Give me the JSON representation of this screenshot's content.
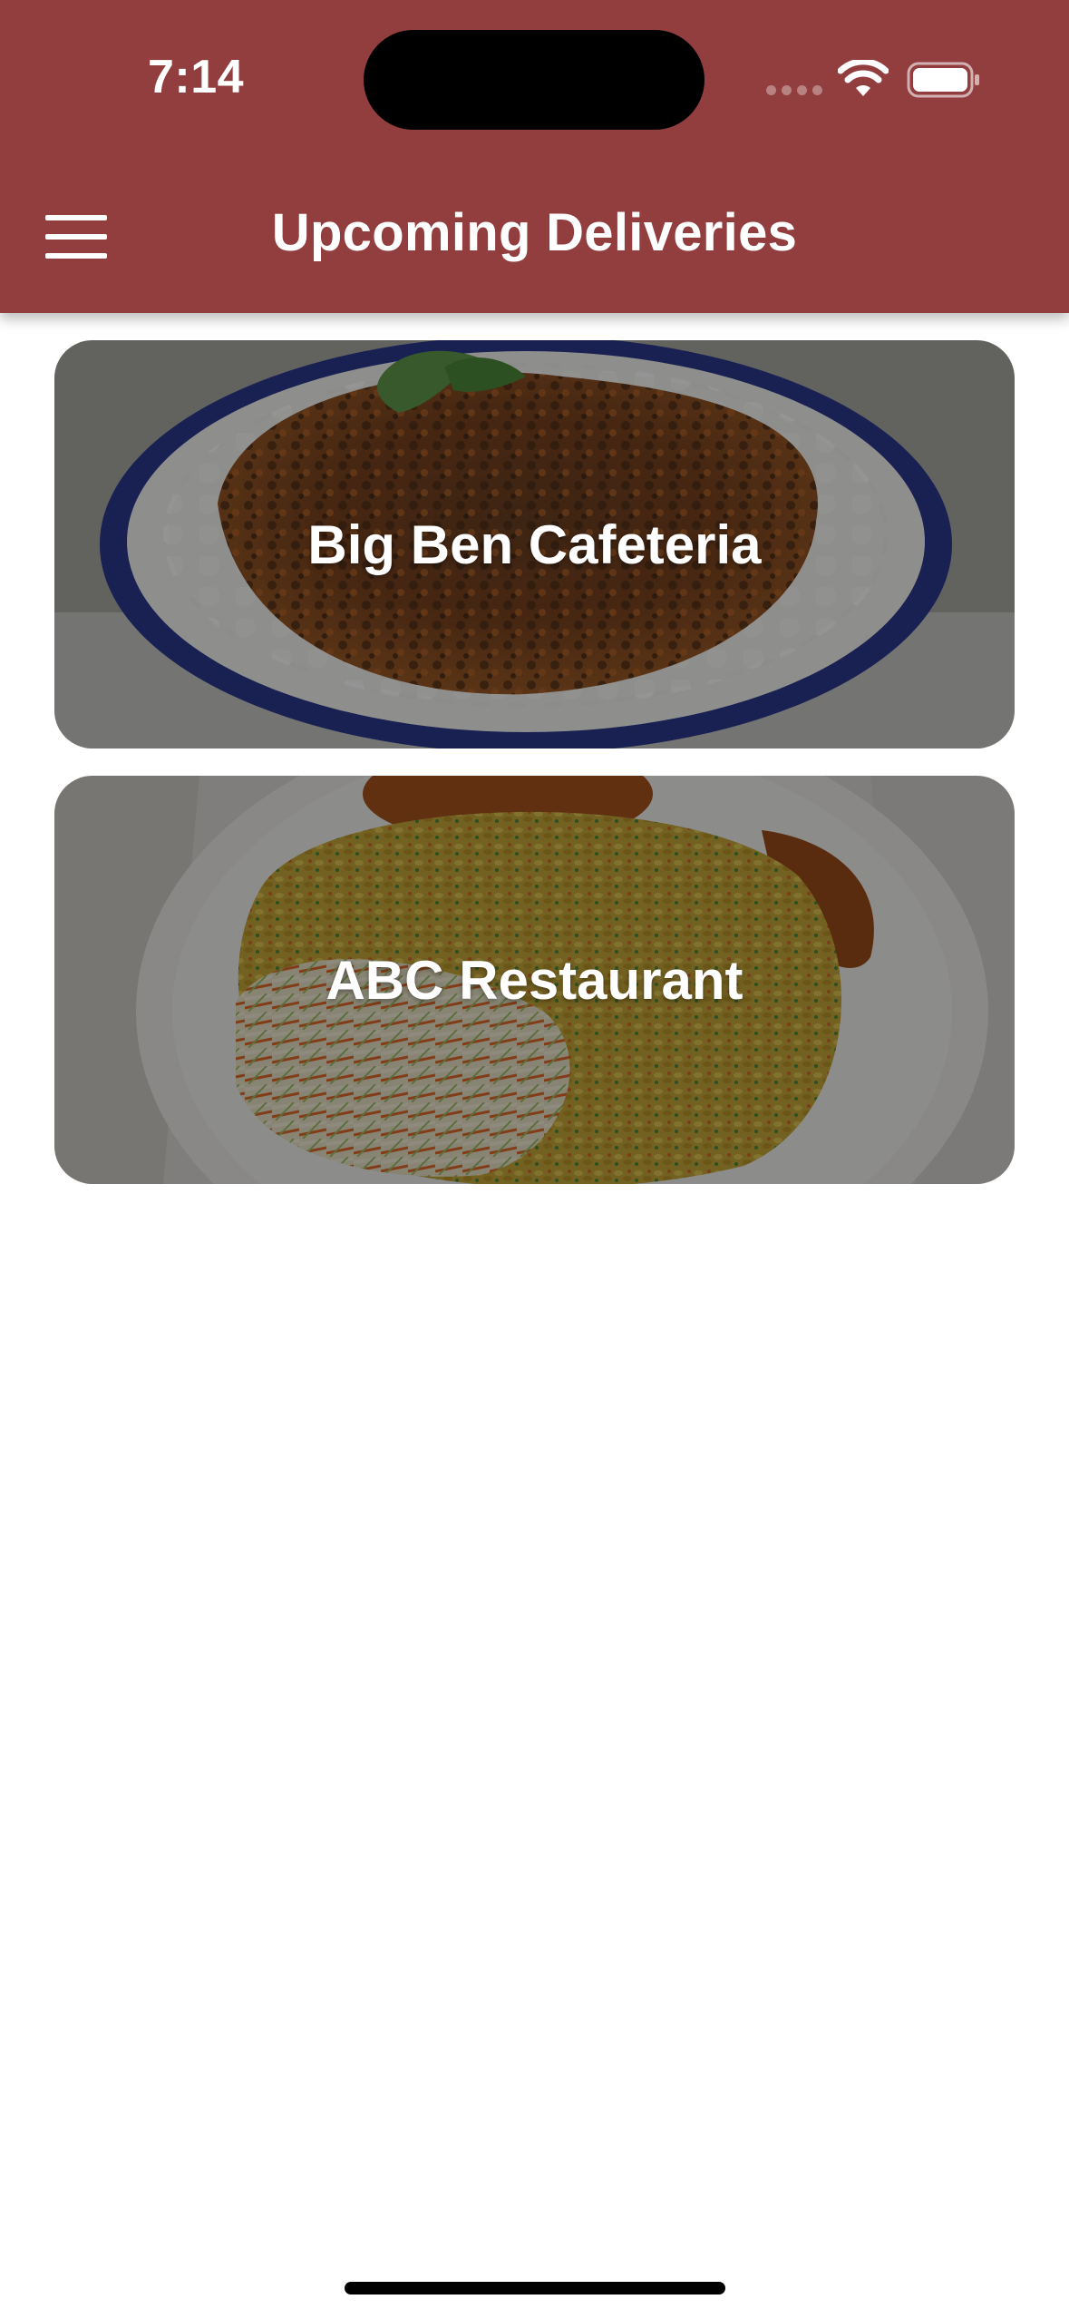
{
  "status_bar": {
    "time": "7:14"
  },
  "header": {
    "title": "Upcoming Deliveries",
    "background_color": "#923e3f",
    "menu_icon": "hamburger-menu-icon"
  },
  "deliveries": [
    {
      "label": "Big Ben Cafeteria"
    },
    {
      "label": "ABC Restaurant"
    }
  ],
  "icons": {
    "wifi": "wifi-icon",
    "battery": "battery-icon",
    "signal": "cellular-signal-icon"
  }
}
